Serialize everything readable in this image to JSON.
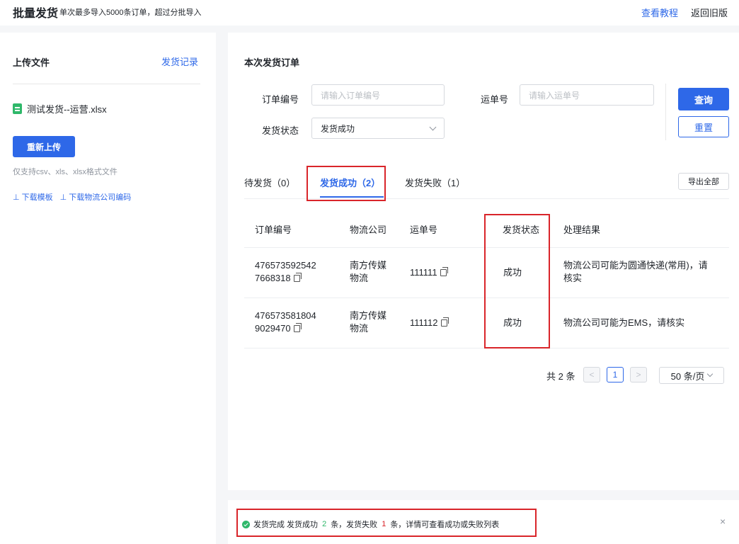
{
  "header": {
    "title": "批量发货",
    "subtitle": "单次最多导入5000条订单，超过分批导入",
    "tutorial_link": "查看教程",
    "old_version_link": "返回旧版"
  },
  "upload": {
    "title": "上传文件",
    "record_link": "发货记录",
    "file_name": "测试发货--运营.xlsx",
    "file_icon": "excel-file-icon",
    "reupload_button": "重新上传",
    "hint": "仅支持csv、xls、xlsx格式文件",
    "download_template": "⊥ 下载模板",
    "download_codes": "⊥ 下载物流公司编码"
  },
  "orders": {
    "title": "本次发货订单",
    "filters": {
      "order_no_label": "订单编号",
      "order_no_placeholder": "请输入订单编号",
      "tracking_label": "运单号",
      "tracking_placeholder": "请输入运单号",
      "status_label": "发货状态",
      "status_value": "发货成功",
      "query_button": "查询",
      "reset_button": "重置"
    },
    "tabs": [
      {
        "label": "待发货（0）"
      },
      {
        "label": "发货成功（2）"
      },
      {
        "label": "发货失败（1）"
      }
    ],
    "export_button": "导出全部",
    "columns": [
      "订单编号",
      "物流公司",
      "运单号",
      "发货状态",
      "处理结果"
    ],
    "rows": [
      {
        "order_line1": "476573592542",
        "order_line2": "7668318",
        "company_line1": "南方传媒",
        "company_line2": "物流",
        "tracking": "111111",
        "status": "成功",
        "result_line1": "物流公司可能为圆通快递(常用)，请",
        "result_line2": "核实"
      },
      {
        "order_line1": "476573581804",
        "order_line2": "9029470",
        "company_line1": "南方传媒",
        "company_line2": "物流",
        "tracking": "111112",
        "status": "成功",
        "result_line1": "物流公司可能为EMS，请核实",
        "result_line2": ""
      }
    ],
    "pagination": {
      "total": "共 2 条",
      "prev": "<",
      "current": "1",
      "next": ">",
      "page_size": "50 条/页"
    }
  },
  "notice": {
    "prefix": "发货完成  发货成功",
    "success_count": "2",
    "mid": "条，发货失败",
    "fail_count": "1",
    "suffix": "条，详情可查看成功或失败列表",
    "close": "×"
  },
  "colors": {
    "accent": "#2e68e8",
    "success": "#2fb86a",
    "highlight_box": "#d9252a"
  }
}
